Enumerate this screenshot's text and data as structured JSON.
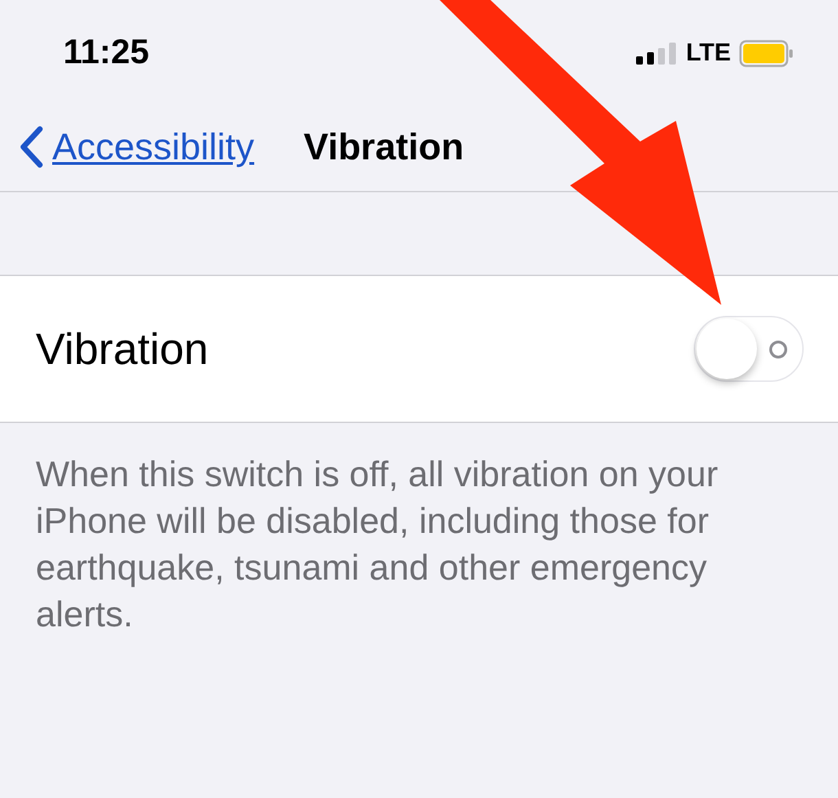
{
  "status_bar": {
    "time": "11:25",
    "network": "LTE"
  },
  "nav": {
    "back": "Accessibility",
    "title": "Vibration"
  },
  "setting": {
    "label": "Vibration",
    "on": false
  },
  "footer": "When this switch is off, all vibration on your iPhone will be disabled, including those for earthquake, tsunami and other emergency alerts."
}
